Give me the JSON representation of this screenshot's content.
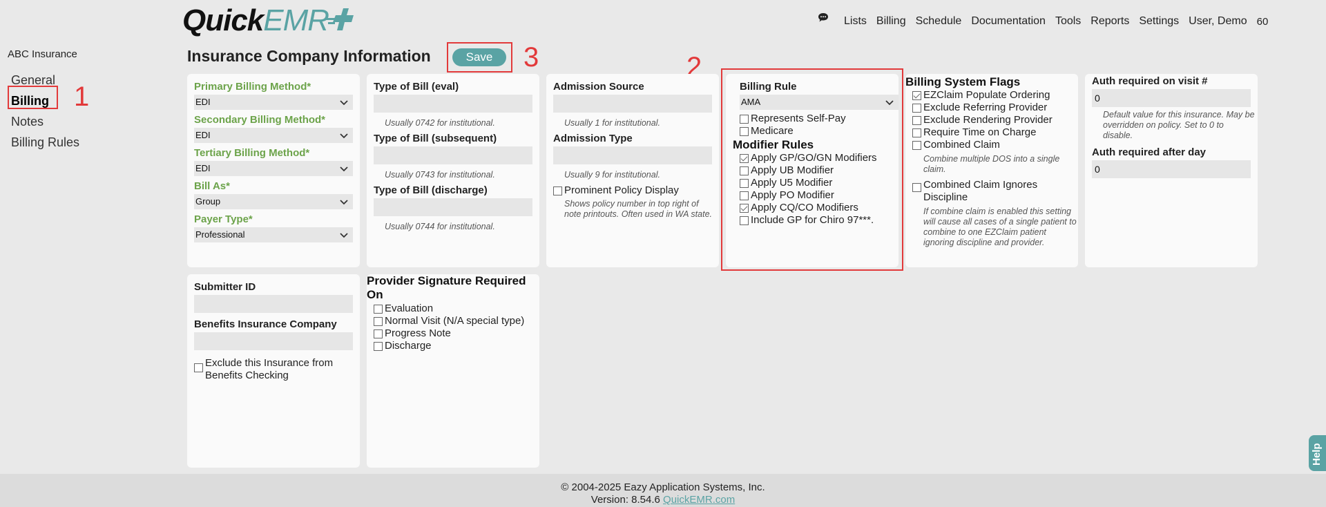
{
  "header": {
    "logo_dark": "Quick",
    "logo_teal": "EMR",
    "nav": [
      "Lists",
      "Billing",
      "Schedule",
      "Documentation",
      "Tools",
      "Reports",
      "Settings",
      "User, Demo"
    ],
    "count": "60",
    "icons": [
      "chat-icon"
    ]
  },
  "sidebar": {
    "company": "ABC Insurance",
    "links": [
      "General",
      "Billing",
      "Notes",
      "Billing Rules"
    ],
    "active": "Billing"
  },
  "page": {
    "title": "Insurance Company Information",
    "save_label": "Save"
  },
  "annotations": {
    "one": "1",
    "two": "2",
    "three": "3"
  },
  "card1": {
    "primary_label": "Primary Billing Method*",
    "primary_value": "EDI",
    "secondary_label": "Secondary Billing Method*",
    "secondary_value": "EDI",
    "tertiary_label": "Tertiary Billing Method*",
    "tertiary_value": "EDI",
    "billas_label": "Bill As*",
    "billas_value": "Group",
    "payer_label": "Payer Type*",
    "payer_value": "Professional"
  },
  "card2": {
    "eval_label": "Type of Bill (eval)",
    "eval_hint": "Usually 0742 for institutional.",
    "subseq_label": "Type of Bill (subsequent)",
    "subseq_hint": "Usually 0743 for institutional.",
    "disch_label": "Type of Bill (discharge)",
    "disch_hint": "Usually 0744 for institutional."
  },
  "card3": {
    "adm_source_label": "Admission Source",
    "adm_source_hint": "Usually 1 for institutional.",
    "adm_type_label": "Admission Type",
    "adm_type_hint": "Usually 9 for institutional.",
    "prominent_label": "Prominent Policy Display",
    "prominent_hint": "Shows policy number in top right of note printouts. Often used in WA state."
  },
  "card4": {
    "rule_label": "Billing Rule",
    "rule_value": "AMA",
    "self_pay": "Represents Self-Pay",
    "medicare": "Medicare",
    "modifier_title": "Modifier Rules",
    "mods": [
      {
        "label": "Apply GP/GO/GN Modifiers",
        "checked": true
      },
      {
        "label": "Apply UB Modifier",
        "checked": false
      },
      {
        "label": "Apply U5 Modifier",
        "checked": false
      },
      {
        "label": "Apply PO Modifier",
        "checked": false
      },
      {
        "label": "Apply CQ/CO Modifiers",
        "checked": true
      },
      {
        "label": "Include GP for Chiro 97***.",
        "checked": false
      }
    ]
  },
  "card5": {
    "title": "Billing System Flags",
    "flags": [
      {
        "label": "EZClaim Populate Ordering",
        "checked": true
      },
      {
        "label": "Exclude Referring Provider",
        "checked": false
      },
      {
        "label": "Exclude Rendering Provider",
        "checked": false
      },
      {
        "label": "Require Time on Charge",
        "checked": false
      },
      {
        "label": "Combined Claim",
        "checked": false
      }
    ],
    "combined_hint": "Combine multiple DOS into a single claim.",
    "ignores_label": "Combined Claim Ignores Discipline",
    "ignores_hint": "If combine claim is enabled this setting will cause all cases of a single patient to combine to one EZClaim patient ignoring discipline and provider."
  },
  "card6": {
    "visit_label": "Auth required on visit #",
    "visit_value": "0",
    "visit_hint": "Default value for this insurance. May be overridden on policy. Set to 0 to disable.",
    "day_label": "Auth required after day",
    "day_value": "0"
  },
  "card7": {
    "submitter_label": "Submitter ID",
    "benefits_label": "Benefits Insurance Company",
    "exclude_label": "Exclude this Insurance from Benefits Checking"
  },
  "card8": {
    "title": "Provider Signature Required On",
    "items": [
      "Evaluation",
      "Normal Visit (N/A special type)",
      "Progress Note",
      "Discharge"
    ]
  },
  "footer": {
    "copyright": "© 2004-2025 Eazy Application Systems, Inc.",
    "version": "Version: 8.54.6",
    "link": "QuickEMR.com"
  },
  "help_label": "Help",
  "colors": {
    "teal": "#5aa3a4",
    "green_label": "#6ca34a",
    "annotation_red": "#e2393a"
  }
}
